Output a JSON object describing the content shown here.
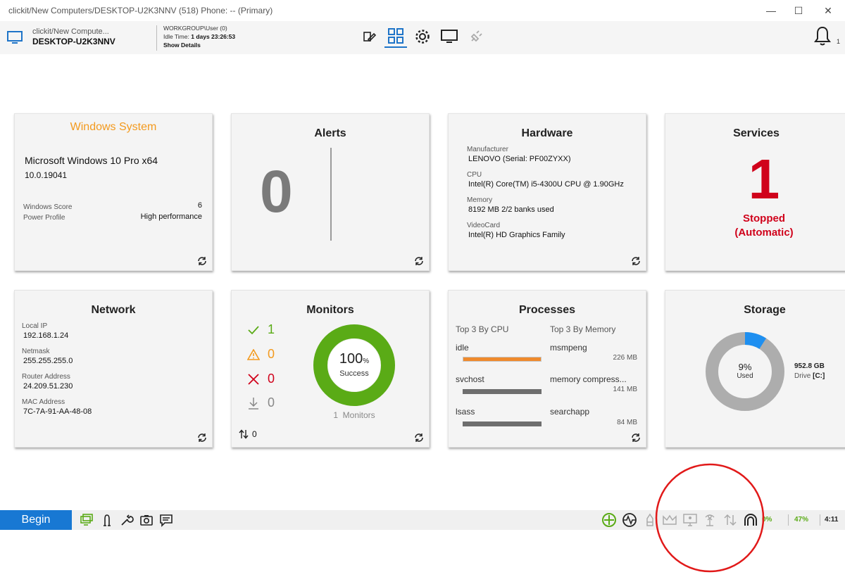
{
  "window": {
    "title": "clickit/New Computers/DESKTOP-U2K3NNV (518) Phone: -- (Primary)",
    "minimize": "—",
    "maximize": "☐",
    "close": "✕"
  },
  "header": {
    "path": "clickit/New Compute...",
    "computer": "DESKTOP-U2K3NNV",
    "user": "WORKGROUP\\User (0)",
    "idle_label": "Idle Time:",
    "idle_value": "1 days 23:26:53",
    "show_details": "Show Details",
    "notifications": "1"
  },
  "cards": {
    "windows": {
      "title": "Windows System",
      "os": "Microsoft Windows 10 Pro x64",
      "version": "10.0.19041",
      "score_label": "Windows Score",
      "score_value": "6",
      "power_label": "Power Profile",
      "power_value": "High performance"
    },
    "alerts": {
      "title": "Alerts",
      "count": "0"
    },
    "hardware": {
      "title": "Hardware",
      "fields": [
        {
          "label": "Manufacturer",
          "value": "LENOVO (Serial: PF00ZYXX)"
        },
        {
          "label": "CPU",
          "value": "Intel(R) Core(TM) i5-4300U CPU @ 1.90GHz"
        },
        {
          "label": "Memory",
          "value": "8192 MB 2/2 banks used"
        },
        {
          "label": "VideoCard",
          "value": "Intel(R) HD Graphics Family"
        }
      ]
    },
    "services": {
      "title": "Services",
      "count": "1",
      "status1": "Stopped",
      "status2": "(Automatic)"
    },
    "network": {
      "title": "Network",
      "fields": [
        {
          "label": "Local IP",
          "value": "192.168.1.24"
        },
        {
          "label": "Netmask",
          "value": "255.255.255.0"
        },
        {
          "label": "Router Address",
          "value": "24.209.51.230"
        },
        {
          "label": "MAC Address",
          "value": "7C-7A-91-AA-48-08"
        }
      ]
    },
    "monitors": {
      "title": "Monitors",
      "ok": "1",
      "warn": "0",
      "fail": "0",
      "down": "0",
      "percent": "100",
      "pct_sign": "%",
      "success": "Success",
      "total": "1  Monitors",
      "sort": "0",
      "success_fraction": 1.0
    },
    "processes": {
      "title": "Processes",
      "cpu_header": "Top 3 By CPU",
      "mem_header": "Top 3 By Memory",
      "cpu": [
        "idle",
        "svchost",
        "lsass"
      ],
      "mem": [
        {
          "name": "msmpeng",
          "size": "226 MB"
        },
        {
          "name": "memory compress...",
          "size": "141 MB"
        },
        {
          "name": "searchapp",
          "size": "84 MB"
        }
      ]
    },
    "storage": {
      "title": "Storage",
      "percent": "9%",
      "used": "Used",
      "size": "952.8 GB",
      "drive_label": "Drive",
      "drive": "[C:]",
      "used_fraction": 0.09
    }
  },
  "taskbar": {
    "begin": "Begin",
    "stat1": "0%",
    "stat2": "47%",
    "time": "4:11"
  },
  "colors": {
    "accent": "#1878d3",
    "orange": "#f39a1e",
    "red": "#d0021b",
    "green": "#5aab16",
    "gray": "#a9a9a9"
  }
}
